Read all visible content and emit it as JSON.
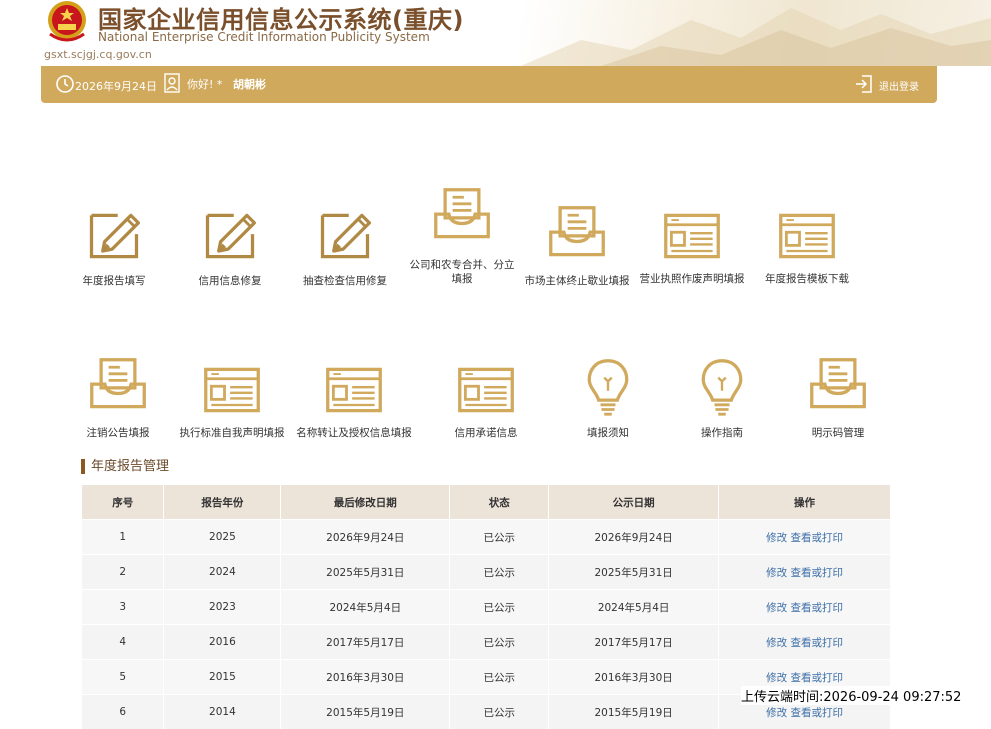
{
  "header": {
    "title_zh": "国家企业信用信息公示系统(重庆)",
    "title_en": "National Enterprise Credit Information Publicity System",
    "domain": "gsxt.scjgj.cq.gov.cn"
  },
  "topbar": {
    "date": "2026年9月24日",
    "greeting": "你好! *",
    "user_name": "胡朝彬",
    "logout": "退出登录"
  },
  "functions_row1": [
    {
      "label": "年度报告填写",
      "icon": "edit-icon"
    },
    {
      "label": "信用信息修复",
      "icon": "edit-icon"
    },
    {
      "label": "抽查检查信用修复",
      "icon": "edit-icon"
    },
    {
      "label_line1": "公司和农专合并、分立",
      "label_line2": "填报",
      "icon": "inbox-icon"
    },
    {
      "label": "市场主体终止歇业填报",
      "icon": "inbox-icon"
    },
    {
      "label": "营业执照作废声明填报",
      "icon": "form-icon"
    },
    {
      "label": "年度报告模板下载",
      "icon": "form-icon"
    }
  ],
  "functions_row2": [
    {
      "label": "注销公告填报",
      "icon": "inbox-icon"
    },
    {
      "label": "执行标准自我声明填报",
      "icon": "form-icon"
    },
    {
      "label": "名称转让及授权信息填报",
      "icon": "form-icon"
    },
    {
      "label": "信用承诺信息",
      "icon": "form-icon"
    },
    {
      "label": "填报须知",
      "icon": "lightbulb-icon"
    },
    {
      "label": "操作指南",
      "icon": "lightbulb-icon"
    },
    {
      "label": "明示码管理",
      "icon": "inbox-icon"
    }
  ],
  "section_title": "年度报告管理",
  "table": {
    "headers": [
      "序号",
      "报告年份",
      "最后修改日期",
      "状态",
      "公示日期",
      "操作"
    ],
    "rows": [
      {
        "no": "1",
        "year": "2025",
        "modified": "2026年9月24日",
        "status": "已公示",
        "published": "2026年9月24日",
        "edit": "修改",
        "view": "查看或打印"
      },
      {
        "no": "2",
        "year": "2024",
        "modified": "2025年5月31日",
        "status": "已公示",
        "published": "2025年5月31日",
        "edit": "修改",
        "view": "查看或打印"
      },
      {
        "no": "3",
        "year": "2023",
        "modified": "2024年5月4日",
        "status": "已公示",
        "published": "2024年5月4日",
        "edit": "修改",
        "view": "查看或打印"
      },
      {
        "no": "4",
        "year": "2016",
        "modified": "2017年5月17日",
        "status": "已公示",
        "published": "2017年5月17日",
        "edit": "修改",
        "view": "查看或打印"
      },
      {
        "no": "5",
        "year": "2015",
        "modified": "2016年3月30日",
        "status": "已公示",
        "published": "2016年3月30日",
        "edit": "修改",
        "view": "查看或打印"
      },
      {
        "no": "6",
        "year": "2014",
        "modified": "2015年5月19日",
        "status": "已公示",
        "published": "2015年5月19日",
        "edit": "修改",
        "view": "查看或打印"
      }
    ]
  },
  "upload_time": "上传云端时间:2026-09-24 09:27:52",
  "colors": {
    "gold": "#d0a95d",
    "brown": "#7a4f2b",
    "link": "#3d6ea8"
  }
}
